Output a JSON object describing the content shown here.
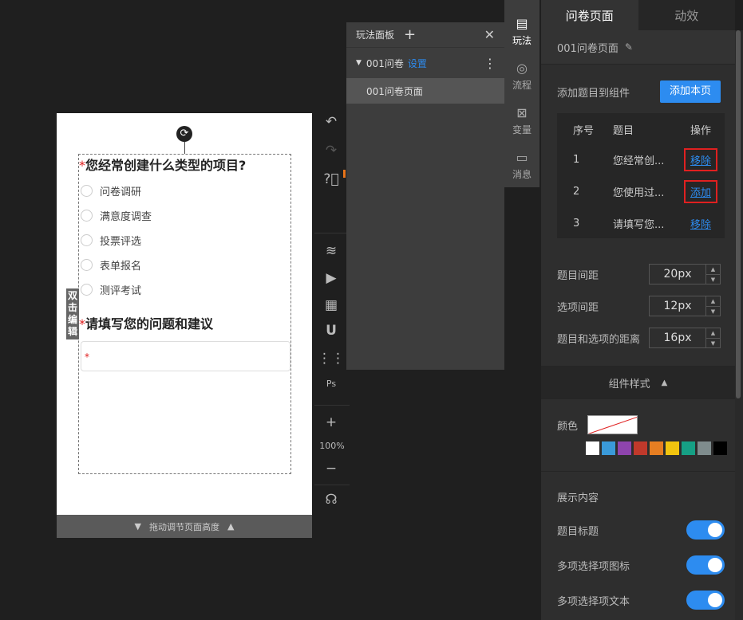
{
  "canvas": {
    "question1": {
      "required_mark": "*",
      "title": "您经常创建什么类型的项目?"
    },
    "options": [
      "问卷调研",
      "满意度调查",
      "投票评选",
      "表单报名",
      "测评考试"
    ],
    "question2": {
      "required_mark": "*",
      "title": "请填写您的问题和建议"
    },
    "textarea_required_mark": "*",
    "double_click_edit": "双击编辑",
    "resize_label": "拖动调节页面高度"
  },
  "toolbar": {
    "zoom": "100%"
  },
  "play_panel": {
    "title": "玩法面板",
    "project_name": "001问卷",
    "settings_link": "设置",
    "page_item": "001问卷页面"
  },
  "side_tabs": [
    {
      "label": "玩法",
      "icon": "play-doc-icon"
    },
    {
      "label": "流程",
      "icon": "flow-icon"
    },
    {
      "label": "变量",
      "icon": "variable-icon"
    },
    {
      "label": "消息",
      "icon": "message-icon"
    }
  ],
  "right_panel": {
    "tabs": [
      "问卷页面",
      "动效"
    ],
    "page_name": "001问卷页面",
    "add_to_component_label": "添加题目到组件",
    "add_this_page_button": "添加本页",
    "table": {
      "headers": [
        "序号",
        "题目",
        "操作"
      ],
      "rows": [
        {
          "index": "1",
          "title": "您经常创...",
          "action": "移除"
        },
        {
          "index": "2",
          "title": "您使用过...",
          "action": "添加"
        },
        {
          "index": "3",
          "title": "请填写您...",
          "action": "移除"
        }
      ]
    },
    "spacing": [
      {
        "label": "题目间距",
        "value": "20px"
      },
      {
        "label": "选项间距",
        "value": "12px"
      },
      {
        "label": "题目和选项的距离",
        "value": "16px"
      }
    ],
    "component_style": "组件样式",
    "color_label": "颜色",
    "palette": [
      "#ffffff",
      "#3a9ad9",
      "#8e44ad",
      "#c0392b",
      "#e67e22",
      "#f1c40f",
      "#16a085",
      "#7f8c8d",
      "#000000"
    ],
    "display_content": "展示内容",
    "toggles": [
      "题目标题",
      "多项选择项图标",
      "多项选择项文本"
    ]
  }
}
